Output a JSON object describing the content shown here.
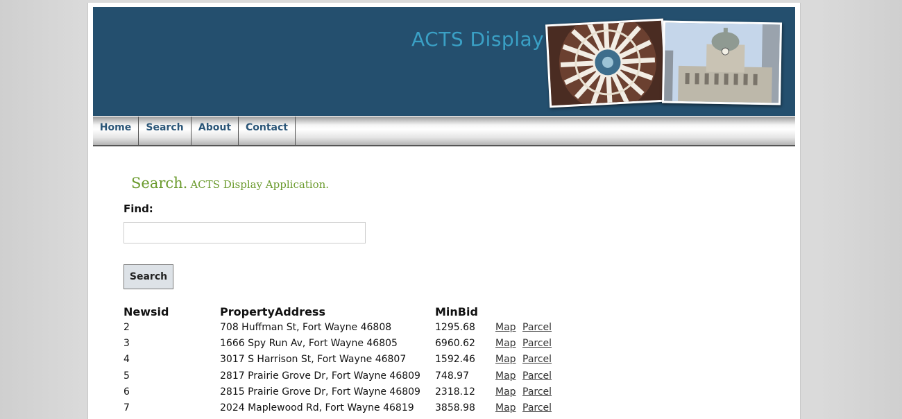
{
  "header": {
    "title": "ACTS Display"
  },
  "nav": {
    "items": [
      {
        "label": "Home"
      },
      {
        "label": "Search"
      },
      {
        "label": "About"
      },
      {
        "label": "Contact"
      }
    ]
  },
  "main": {
    "heading": "Search.",
    "subheading": "ACTS Display Application.",
    "find_label": "Find:",
    "find_value": "",
    "search_button": "Search"
  },
  "table": {
    "columns": [
      "Newsid",
      "PropertyAddress",
      "MinBid"
    ],
    "link_map": "Map",
    "link_parcel": "Parcel",
    "rows": [
      {
        "newsid": "2",
        "address": "708 Huffman St, Fort Wayne 46808",
        "minbid": "1295.68"
      },
      {
        "newsid": "3",
        "address": "1666 Spy Run Av, Fort Wayne 46805",
        "minbid": "6960.62"
      },
      {
        "newsid": "4",
        "address": "3017 S Harrison St, Fort Wayne 46807",
        "minbid": "1592.46"
      },
      {
        "newsid": "5",
        "address": "2817 Prairie Grove Dr, Fort Wayne 46809",
        "minbid": "748.97"
      },
      {
        "newsid": "6",
        "address": "2815 Prairie Grove Dr, Fort Wayne 46809",
        "minbid": "2318.12"
      },
      {
        "newsid": "7",
        "address": "2024 Maplewood Rd, Fort Wayne 46819",
        "minbid": "3858.98"
      }
    ]
  },
  "colors": {
    "header_bg": "#244f6e",
    "title": "#3aa0c5",
    "heading": "#6a9a2c",
    "nav_text": "#2a5577"
  }
}
